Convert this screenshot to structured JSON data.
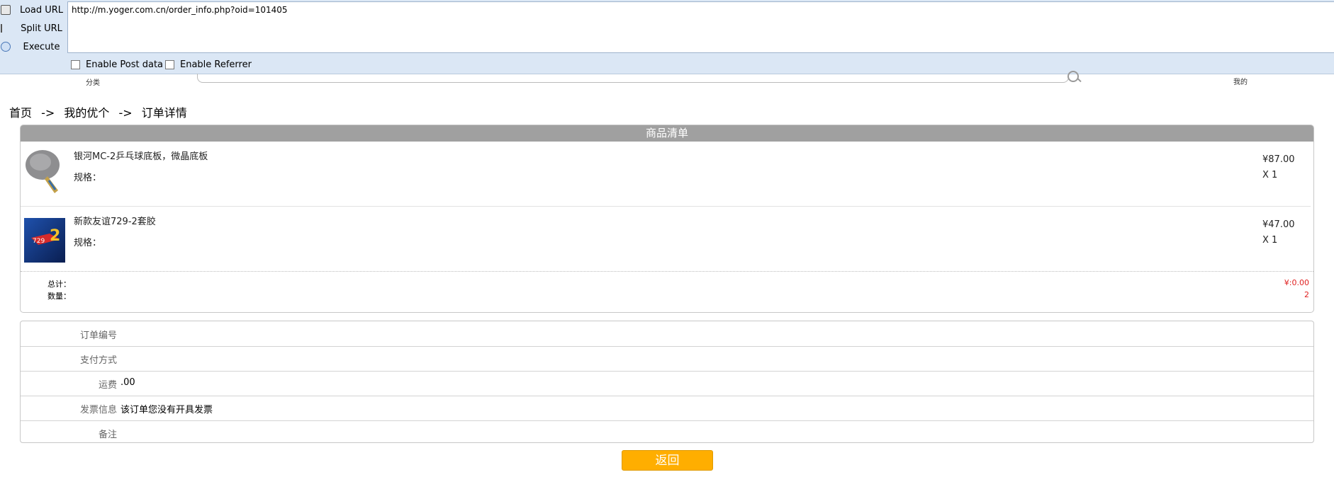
{
  "hackbar": {
    "load_url": "Load URL",
    "split_url": "Split URL",
    "execute": "Execute",
    "url": "http://m.yoger.com.cn/order_info.php?oid=101405",
    "enable_post": "Enable Post data",
    "enable_referrer": "Enable Referrer"
  },
  "header": {
    "category": "分类",
    "mine": "我的"
  },
  "breadcrumb": [
    "首页",
    "->",
    "我的优个",
    "->",
    "订单详情"
  ],
  "goods": {
    "title": "商品清单",
    "items": [
      {
        "name": "银河MC-2乒乓球底板，微晶底板",
        "spec": "规格：",
        "price": "¥87.00",
        "qty": "X 1"
      },
      {
        "name": "新款友谊729-2套胶",
        "spec": "规格：",
        "price": "¥47.00",
        "qty": "X 1"
      }
    ],
    "total_label": "总计：",
    "total_value": "¥:0.00",
    "count_label": "数量：",
    "count_value": "2"
  },
  "info": [
    {
      "key": "订单编号",
      "value": ""
    },
    {
      "key": "支付方式",
      "value": ""
    },
    {
      "key": "运费",
      "value": ".00"
    },
    {
      "key": "发票信息",
      "value": "该订单您没有开具发票"
    },
    {
      "key": "备注",
      "value": ""
    }
  ],
  "back_label": "返回",
  "colors": {
    "accent": "#ffae00",
    "total_red": "#e02020",
    "header_gray": "#a0a0a0",
    "toolbar_bg": "#dbe7f5"
  }
}
